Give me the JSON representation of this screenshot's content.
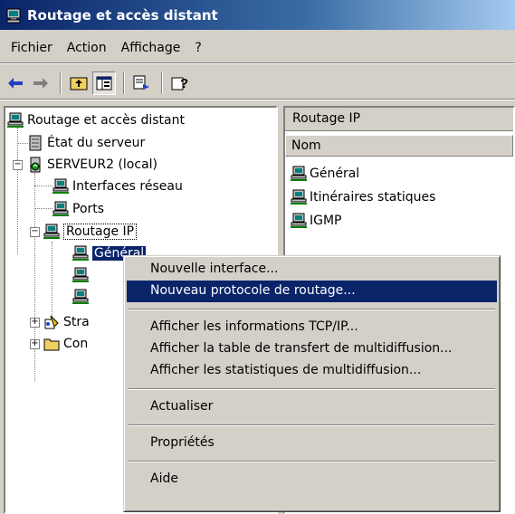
{
  "window": {
    "title": "Routage et accès distant"
  },
  "menubar": {
    "items": [
      "Fichier",
      "Action",
      "Affichage",
      "?"
    ]
  },
  "toolbar": {
    "buttons": [
      "back-arrow-icon",
      "forward-arrow-icon",
      "up-folder-icon",
      "show-hide-tree-icon",
      "export-list-icon",
      "help-icon"
    ]
  },
  "tree": {
    "root": "Routage et accès distant",
    "server_status": "État du serveur",
    "server": "SERVEUR2 (local)",
    "interfaces": "Interfaces réseau",
    "ports": "Ports",
    "ip_routing": "Routage IP",
    "general_partial": "Général",
    "strategies_partial": "Stra",
    "connexions_partial": "Con"
  },
  "right_pane": {
    "title": "Routage IP",
    "column": "Nom",
    "items": [
      "Général",
      "Itinéraires statiques",
      "IGMP"
    ]
  },
  "context_menu": {
    "new_interface": "Nouvelle interface...",
    "new_protocol": "Nouveau protocole de routage...",
    "show_tcpip": "Afficher les informations TCP/IP...",
    "show_multicast_table": "Afficher la table de transfert de multidiffusion...",
    "show_multicast_stats": "Afficher les statistiques de multidiffusion...",
    "refresh": "Actualiser",
    "properties": "Propriétés",
    "help": "Aide"
  },
  "colors": {
    "selection": "#0a246a",
    "face": "#d4d0c8"
  }
}
